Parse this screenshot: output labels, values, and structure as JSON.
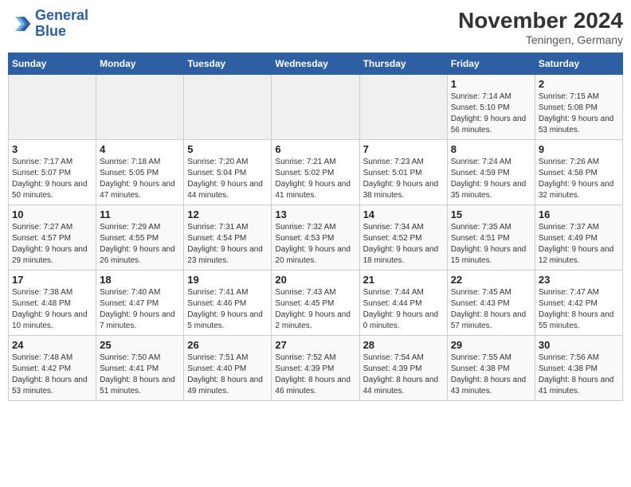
{
  "logo": {
    "line1": "General",
    "line2": "Blue"
  },
  "title": "November 2024",
  "subtitle": "Teningen, Germany",
  "headers": [
    "Sunday",
    "Monday",
    "Tuesday",
    "Wednesday",
    "Thursday",
    "Friday",
    "Saturday"
  ],
  "weeks": [
    [
      {
        "day": "",
        "detail": ""
      },
      {
        "day": "",
        "detail": ""
      },
      {
        "day": "",
        "detail": ""
      },
      {
        "day": "",
        "detail": ""
      },
      {
        "day": "",
        "detail": ""
      },
      {
        "day": "1",
        "detail": "Sunrise: 7:14 AM\nSunset: 5:10 PM\nDaylight: 9 hours and 56 minutes."
      },
      {
        "day": "2",
        "detail": "Sunrise: 7:15 AM\nSunset: 5:08 PM\nDaylight: 9 hours and 53 minutes."
      }
    ],
    [
      {
        "day": "3",
        "detail": "Sunrise: 7:17 AM\nSunset: 5:07 PM\nDaylight: 9 hours and 50 minutes."
      },
      {
        "day": "4",
        "detail": "Sunrise: 7:18 AM\nSunset: 5:05 PM\nDaylight: 9 hours and 47 minutes."
      },
      {
        "day": "5",
        "detail": "Sunrise: 7:20 AM\nSunset: 5:04 PM\nDaylight: 9 hours and 44 minutes."
      },
      {
        "day": "6",
        "detail": "Sunrise: 7:21 AM\nSunset: 5:02 PM\nDaylight: 9 hours and 41 minutes."
      },
      {
        "day": "7",
        "detail": "Sunrise: 7:23 AM\nSunset: 5:01 PM\nDaylight: 9 hours and 38 minutes."
      },
      {
        "day": "8",
        "detail": "Sunrise: 7:24 AM\nSunset: 4:59 PM\nDaylight: 9 hours and 35 minutes."
      },
      {
        "day": "9",
        "detail": "Sunrise: 7:26 AM\nSunset: 4:58 PM\nDaylight: 9 hours and 32 minutes."
      }
    ],
    [
      {
        "day": "10",
        "detail": "Sunrise: 7:27 AM\nSunset: 4:57 PM\nDaylight: 9 hours and 29 minutes."
      },
      {
        "day": "11",
        "detail": "Sunrise: 7:29 AM\nSunset: 4:55 PM\nDaylight: 9 hours and 26 minutes."
      },
      {
        "day": "12",
        "detail": "Sunrise: 7:31 AM\nSunset: 4:54 PM\nDaylight: 9 hours and 23 minutes."
      },
      {
        "day": "13",
        "detail": "Sunrise: 7:32 AM\nSunset: 4:53 PM\nDaylight: 9 hours and 20 minutes."
      },
      {
        "day": "14",
        "detail": "Sunrise: 7:34 AM\nSunset: 4:52 PM\nDaylight: 9 hours and 18 minutes."
      },
      {
        "day": "15",
        "detail": "Sunrise: 7:35 AM\nSunset: 4:51 PM\nDaylight: 9 hours and 15 minutes."
      },
      {
        "day": "16",
        "detail": "Sunrise: 7:37 AM\nSunset: 4:49 PM\nDaylight: 9 hours and 12 minutes."
      }
    ],
    [
      {
        "day": "17",
        "detail": "Sunrise: 7:38 AM\nSunset: 4:48 PM\nDaylight: 9 hours and 10 minutes."
      },
      {
        "day": "18",
        "detail": "Sunrise: 7:40 AM\nSunset: 4:47 PM\nDaylight: 9 hours and 7 minutes."
      },
      {
        "day": "19",
        "detail": "Sunrise: 7:41 AM\nSunset: 4:46 PM\nDaylight: 9 hours and 5 minutes."
      },
      {
        "day": "20",
        "detail": "Sunrise: 7:43 AM\nSunset: 4:45 PM\nDaylight: 9 hours and 2 minutes."
      },
      {
        "day": "21",
        "detail": "Sunrise: 7:44 AM\nSunset: 4:44 PM\nDaylight: 9 hours and 0 minutes."
      },
      {
        "day": "22",
        "detail": "Sunrise: 7:45 AM\nSunset: 4:43 PM\nDaylight: 8 hours and 57 minutes."
      },
      {
        "day": "23",
        "detail": "Sunrise: 7:47 AM\nSunset: 4:42 PM\nDaylight: 8 hours and 55 minutes."
      }
    ],
    [
      {
        "day": "24",
        "detail": "Sunrise: 7:48 AM\nSunset: 4:42 PM\nDaylight: 8 hours and 53 minutes."
      },
      {
        "day": "25",
        "detail": "Sunrise: 7:50 AM\nSunset: 4:41 PM\nDaylight: 8 hours and 51 minutes."
      },
      {
        "day": "26",
        "detail": "Sunrise: 7:51 AM\nSunset: 4:40 PM\nDaylight: 8 hours and 49 minutes."
      },
      {
        "day": "27",
        "detail": "Sunrise: 7:52 AM\nSunset: 4:39 PM\nDaylight: 8 hours and 46 minutes."
      },
      {
        "day": "28",
        "detail": "Sunrise: 7:54 AM\nSunset: 4:39 PM\nDaylight: 8 hours and 44 minutes."
      },
      {
        "day": "29",
        "detail": "Sunrise: 7:55 AM\nSunset: 4:38 PM\nDaylight: 8 hours and 43 minutes."
      },
      {
        "day": "30",
        "detail": "Sunrise: 7:56 AM\nSunset: 4:38 PM\nDaylight: 8 hours and 41 minutes."
      }
    ]
  ]
}
